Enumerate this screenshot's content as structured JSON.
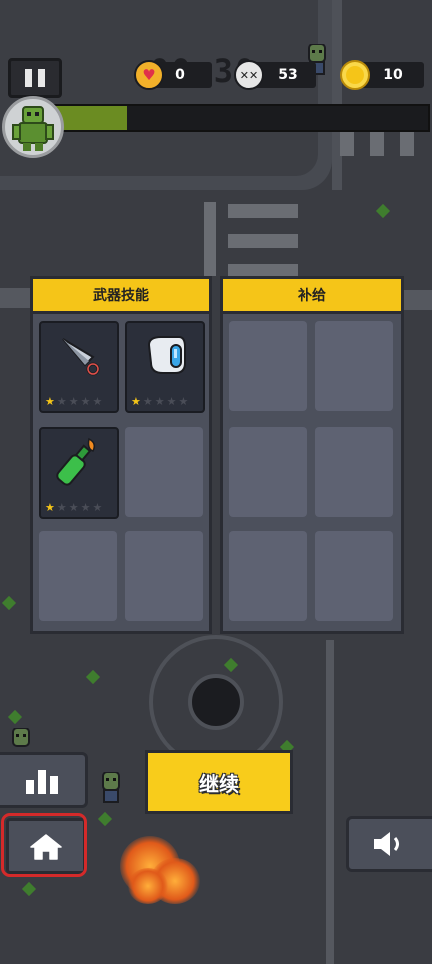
{
  "hud": {
    "timer": "00:30",
    "hearts": "0",
    "kills": "53",
    "coins": "10"
  },
  "panels": {
    "weapons_title": "武器技能",
    "supplies_title": "补给"
  },
  "weapons": [
    {
      "icon": "kunai-icon",
      "stars": 1
    },
    {
      "icon": "magnet-icon",
      "stars": 1
    },
    {
      "icon": "molotov-icon",
      "stars": 1
    }
  ],
  "buttons": {
    "continue": "继续"
  },
  "colors": {
    "accent_yellow": "#f5c518",
    "highlight_red": "#d42a2a",
    "panel": "#4c505c"
  }
}
